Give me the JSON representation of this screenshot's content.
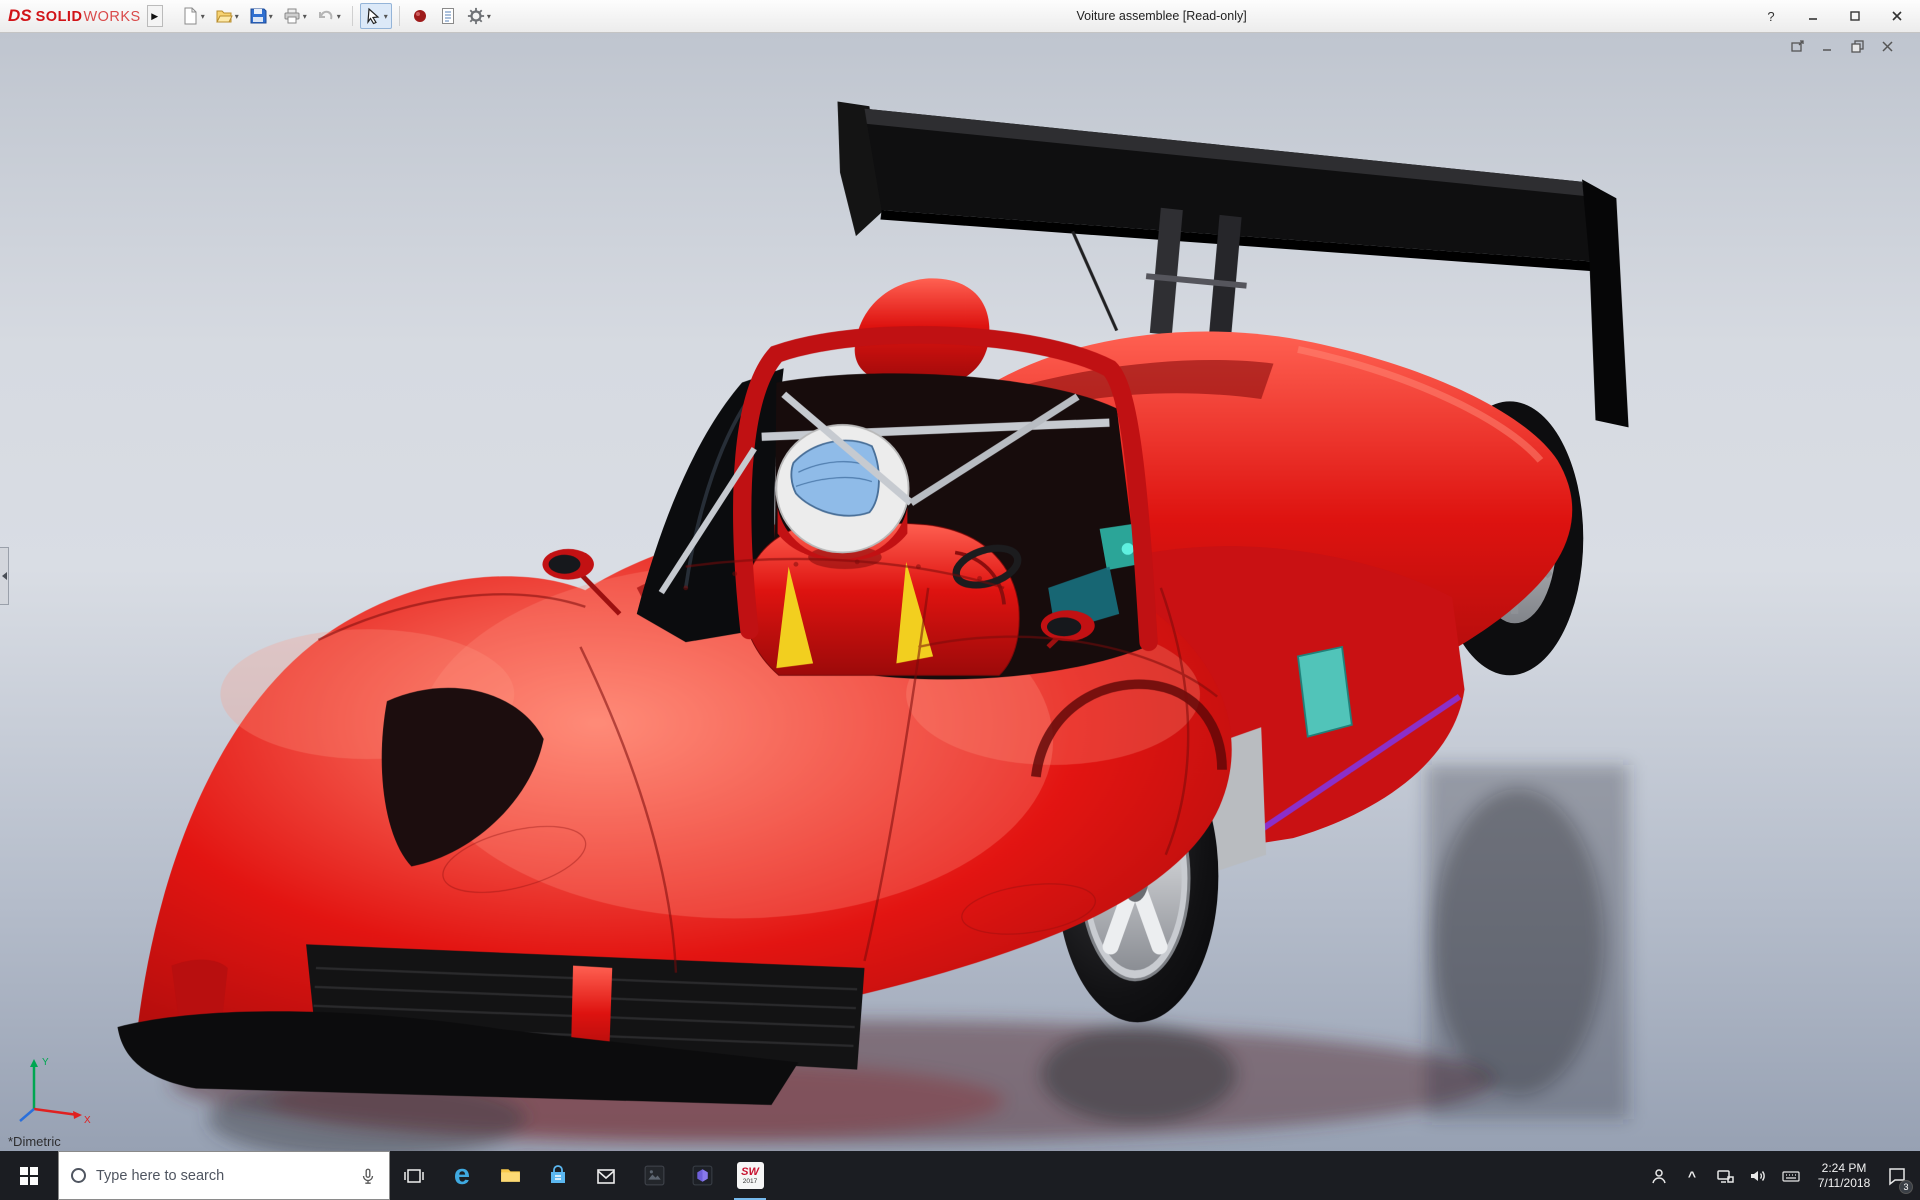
{
  "titlebar": {
    "brand_ds": "DS",
    "brand_solid": "SOLID",
    "brand_works": "WORKS",
    "flyout_arrow": "▶",
    "title": "Voiture assemblee [Read-only]",
    "help_glyph": "?"
  },
  "toolbar": {
    "icons": [
      "new-document",
      "open-document",
      "save",
      "print",
      "undo",
      "select-arrow",
      "rebuild-sphere",
      "file-properties",
      "options-gear"
    ]
  },
  "doc_window": {
    "controls": [
      "float-window",
      "minimize",
      "restore",
      "close"
    ]
  },
  "viewport": {
    "view_label": "*Dimetric",
    "triad": {
      "x_label": "X",
      "y_label": "Y"
    }
  },
  "taskbar": {
    "search_placeholder": "Type here to search",
    "edge_glyph": "e",
    "sw_label": "SW",
    "sw_year": "2017",
    "chevron_glyph": "^",
    "clock_time": "2:24 PM",
    "clock_date": "7/11/2018",
    "badge_count": "3",
    "apps": [
      "start",
      "search",
      "task-view",
      "edge",
      "file-explorer",
      "store",
      "mail",
      "photos",
      "mixed-reality-viewer",
      "solidworks"
    ]
  },
  "colors": {
    "car_body_red": "#d41216",
    "wing_black": "#101010",
    "visor_blue": "#7fb3e8",
    "interior_teal": "#2ba598",
    "trim_purple": "#8b2fc9",
    "taskbar_bg": "#1b1d22",
    "running_underline": "#76b9ed"
  }
}
